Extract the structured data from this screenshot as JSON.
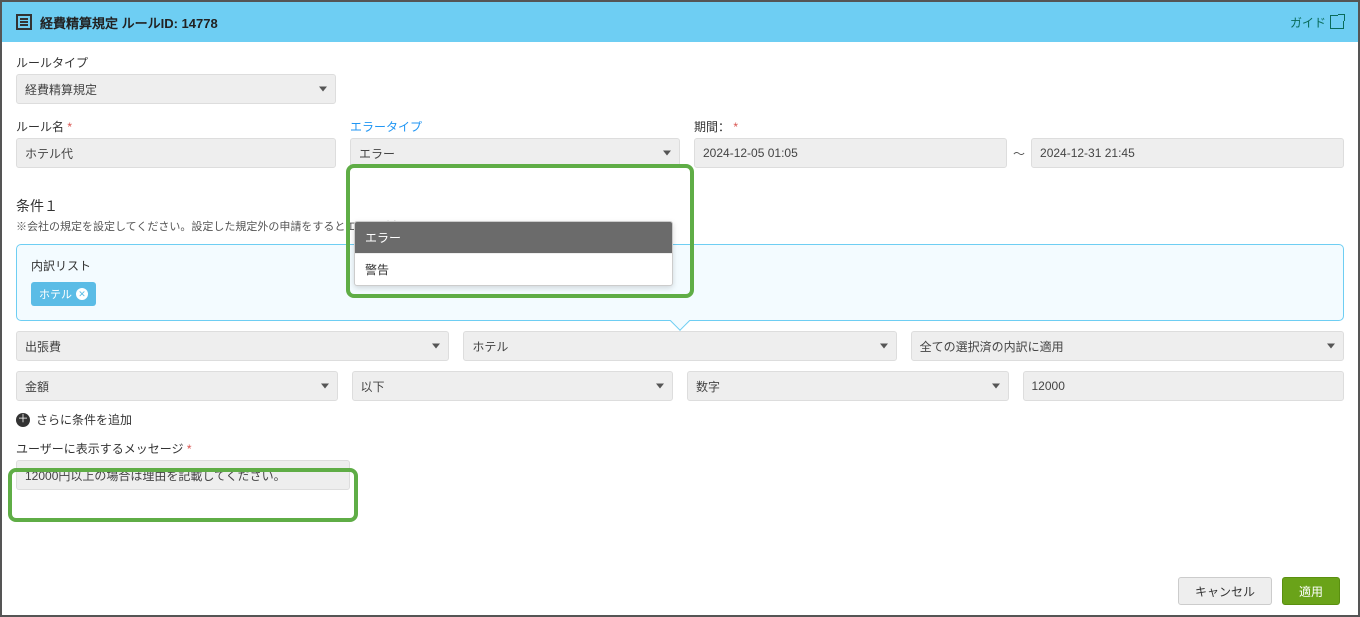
{
  "header": {
    "title": "経費精算規定 ルールID: 14778",
    "guide": "ガイド"
  },
  "labels": {
    "rule_type": "ルールタイプ",
    "rule_name": "ルール名",
    "error_type": "エラータイプ",
    "period": "期間：",
    "condition_heading": "条件１",
    "condition_sub": "※会社の規定を設定してください。設定した規定外の申請をするとエラーが出ます。",
    "breakdown_list": "内訳リスト",
    "add_condition": "さらに条件を追加",
    "user_message": "ユーザーに表示するメッセージ"
  },
  "values": {
    "rule_type": "経費精算規定",
    "rule_name": "ホテル代",
    "error_type": "エラー",
    "period_from": "2024-12-05 01:05",
    "period_to": "2024-12-31 21:45",
    "tag": "ホテル",
    "c1a": "出張費",
    "c1b": "ホテル",
    "c1c": "全ての選択済の内訳に適用",
    "c2a": "金額",
    "c2b": "以下",
    "c2c": "数字",
    "c2d": "12000",
    "user_message": "12000円以上の場合は理由を記載してください。",
    "tilde": "～"
  },
  "error_type_options": [
    "エラー",
    "警告"
  ],
  "buttons": {
    "cancel": "キャンセル",
    "apply": "適用"
  }
}
